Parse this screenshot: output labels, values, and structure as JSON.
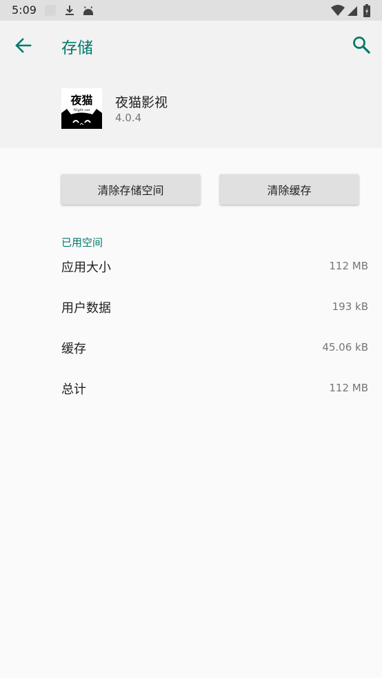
{
  "status_bar": {
    "time": "5:09",
    "icons": [
      "blank-notification-icon",
      "download-icon",
      "android-icon",
      "wifi-icon",
      "signal-icon",
      "battery-icon"
    ]
  },
  "app_bar": {
    "title": "存储",
    "back_icon": "arrow-back-icon",
    "search_icon": "search-icon",
    "accent_color": "#00796b"
  },
  "app": {
    "icon_text": "夜猫",
    "icon_subtext": "Night cat",
    "name": "夜猫影视",
    "version": "4.0.4"
  },
  "buttons": {
    "clear_storage": "清除存储空间",
    "clear_cache": "清除缓存"
  },
  "usage": {
    "section_title": "已用空间",
    "rows": [
      {
        "label": "应用大小",
        "value": "112 MB"
      },
      {
        "label": "用户数据",
        "value": "193 kB"
      },
      {
        "label": "缓存",
        "value": "45.06 kB"
      },
      {
        "label": "总计",
        "value": "112 MB"
      }
    ]
  }
}
